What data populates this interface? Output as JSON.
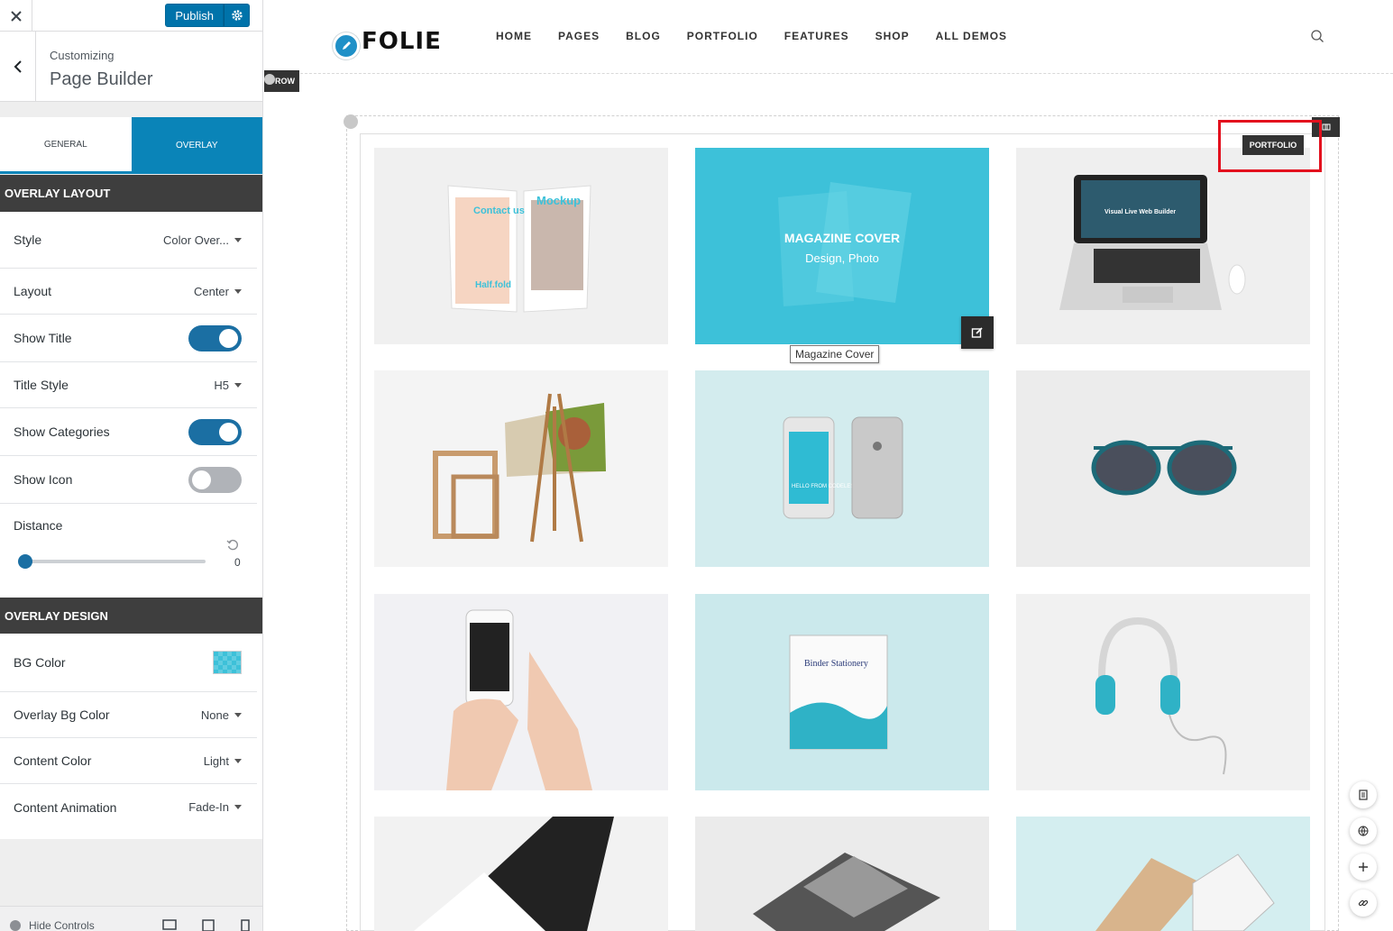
{
  "customizer": {
    "close_icon": "close-icon",
    "publish_label": "Publish",
    "gear_icon": "gear-icon",
    "header": {
      "customizing_label": "Customizing",
      "section_title": "Page Builder"
    },
    "tabs": [
      {
        "label": "GENERAL",
        "active": false
      },
      {
        "label": "OVERLAY",
        "active": true
      }
    ],
    "groups": {
      "layout_title": "OVERLAY LAYOUT",
      "design_title": "OVERLAY DESIGN"
    },
    "rows": {
      "style": {
        "label": "Style",
        "value": "Color Over..."
      },
      "layout": {
        "label": "Layout",
        "value": "Center"
      },
      "show_title": {
        "label": "Show Title",
        "on": true
      },
      "title_style": {
        "label": "Title Style",
        "value": "H5"
      },
      "show_categories": {
        "label": "Show Categories",
        "on": true
      },
      "show_icon": {
        "label": "Show Icon",
        "on": false
      },
      "distance": {
        "label": "Distance",
        "value": "0"
      },
      "bg_color": {
        "label": "BG Color",
        "color": "#3dc1d9"
      },
      "overlay_bg_color": {
        "label": "Overlay Bg Color",
        "value": "None"
      },
      "content_color": {
        "label": "Content Color",
        "value": "Light"
      },
      "content_animation": {
        "label": "Content Animation",
        "value": "Fade-In"
      }
    },
    "footer": {
      "hide_controls": "Hide Controls"
    }
  },
  "site": {
    "logo_text": "FOLIE",
    "logo_badge": "wp",
    "nav": [
      "HOME",
      "PAGES",
      "BLOG",
      "PORTFOLIO",
      "FEATURES",
      "SHOP",
      "ALL DEMOS"
    ],
    "row_badge": "ROW",
    "portfolio_tag": "PORTFOLIO",
    "hovered_item": {
      "title": "MAGAZINE COVER",
      "categories": "Design, Photo",
      "tooltip": "Magazine Cover"
    },
    "tile_texts": {
      "contact": "Contact us",
      "mockup": "Mockup",
      "halffold": "Half.fold",
      "laptop": "Visual Live Web Builder",
      "phone": "HELLO FROM CODELESS",
      "binder": "Binder Stationery"
    },
    "accent_color": "#3dc1d9"
  }
}
